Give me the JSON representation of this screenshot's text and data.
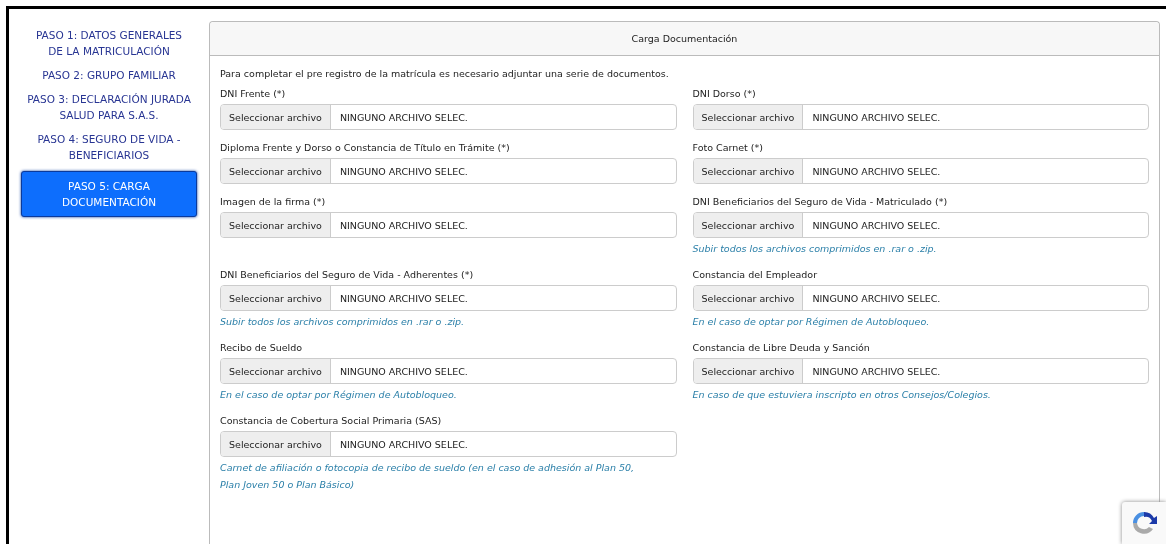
{
  "sidebar": {
    "items": [
      {
        "label": "PASO 1: DATOS GENERALES DE LA MATRICULACIÓN",
        "selected": false
      },
      {
        "label": "PASO 2: GRUPO FAMILIAR",
        "selected": false
      },
      {
        "label": "PASO 3: DECLARACIÓN JURADA SALUD PARA S.A.S.",
        "selected": false
      },
      {
        "label": "PASO 4: SEGURO DE VIDA - BENEFICIARIOS",
        "selected": false
      },
      {
        "label": "PASO 5: CARGA DOCUMENTACIÓN",
        "selected": true
      }
    ]
  },
  "panel": {
    "title": "Carga Documentación",
    "intro": "Para completar el pre registro de la matrícula es necesario adjuntar una serie de documentos.",
    "fields": [
      {
        "label": "DNI Frente (*)",
        "button": "Seleccionar archivo",
        "value": "NINGUNO ARCHIVO SELEC."
      },
      {
        "label": "DNI Dorso (*)",
        "button": "Seleccionar archivo",
        "value": "NINGUNO ARCHIVO SELEC."
      },
      {
        "label": "Diploma Frente y Dorso o Constancia de Título en Trámite (*)",
        "button": "Seleccionar archivo",
        "value": "NINGUNO ARCHIVO SELEC."
      },
      {
        "label": "Foto Carnet (*)",
        "button": "Seleccionar archivo",
        "value": "NINGUNO ARCHIVO SELEC."
      },
      {
        "label": "Imagen de la firma (*)",
        "button": "Seleccionar archivo",
        "value": "NINGUNO ARCHIVO SELEC."
      },
      {
        "label": "DNI Beneficiarios del Seguro de Vida - Matriculado (*)",
        "button": "Seleccionar archivo",
        "value": "NINGUNO ARCHIVO SELEC.",
        "hint": "Subir todos los archivos comprimidos en .rar o .zip."
      },
      {
        "label": "DNI Beneficiarios del Seguro de Vida - Adherentes (*)",
        "button": "Seleccionar archivo",
        "value": "NINGUNO ARCHIVO SELEC.",
        "hint": "Subir todos los archivos comprimidos en .rar o .zip."
      },
      {
        "label": "Constancia del Empleador",
        "button": "Seleccionar archivo",
        "value": "NINGUNO ARCHIVO SELEC.",
        "hint": "En el caso de optar por Régimen de Autobloqueo."
      },
      {
        "label": "Recibo de Sueldo",
        "button": "Seleccionar archivo",
        "value": "NINGUNO ARCHIVO SELEC.",
        "hint": "En el caso de optar por Régimen de Autobloqueo."
      },
      {
        "label": "Constancia de Libre Deuda y Sanción",
        "button": "Seleccionar archivo",
        "value": "NINGUNO ARCHIVO SELEC.",
        "hint": "En caso de que estuviera inscripto en otros Consejos/Colegios."
      },
      {
        "label": "Constancia de Cobertura Social Primaria (SAS)",
        "button": "Seleccionar archivo",
        "value": "NINGUNO ARCHIVO SELEC.",
        "hint": "Carnet de afiliación o fotocopia de recibo de sueldo (en el caso de adhesión al Plan 50, Plan Joven 50 o Plan Básico)"
      }
    ]
  }
}
